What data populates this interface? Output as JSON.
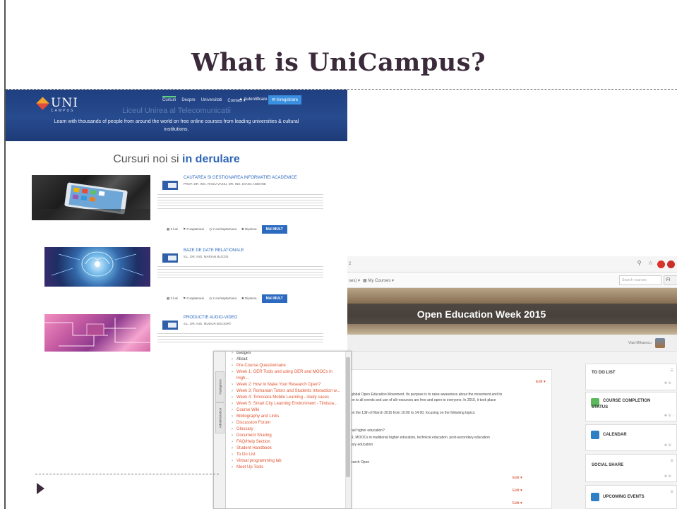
{
  "slide": {
    "title": "What is UniCampus?"
  },
  "unicampus": {
    "logo_text": "UNI",
    "logo_sub": "CAMPUS",
    "nav": [
      "Cursuri",
      "Despre",
      "Universitati",
      "Contact ▾"
    ],
    "login_label": "▲ Autentificare",
    "register_label": "✉ Inregistrare",
    "hero_faded": "Liceul Unirea al Telecomunicatii",
    "hero_text": "Learn with thousands of people from around the world on free online courses from leading universities & cultural institutions.",
    "section_title_pre": "Cursuri noi si ",
    "section_title_highlight": "in derulare",
    "courses": [
      {
        "title": "CAUTAREA SI GESTIONAREA INFORMATIEI ACADEMICE",
        "authors": "PROF. DR. ING. RADU VASIU, DR. ING. DIANA ANDONE",
        "meta": [
          "▦ 3 luni",
          "⚑ 0 saptamani",
          "◷ 2 ore/saptamana",
          "✱ Diploma"
        ],
        "button": "MAI MULT"
      },
      {
        "title": "BAZE DE DATE RELATIONALE",
        "authors": "S.L. DR. ING. MARIAN BUCOS",
        "meta": [
          "▦ 3 luni",
          "⚑ 0 saptamani",
          "◷ 2 ore/saptamana",
          "✱ Diploma"
        ],
        "button": "MAI MULT"
      },
      {
        "title": "PRODUCTIE AUDIO-VIDEO",
        "authors": "S.L. DR. ING. MUGUR BOCIORT"
      }
    ]
  },
  "moodle": {
    "addr_fragment": "2",
    "menu_fragment": "ses) ▾",
    "my_courses": "▦ My Courses ▾",
    "search_placeholder": "Search courses",
    "lang_label": "Fl",
    "banner_title": "Open Education Week 2015",
    "user_name": "Vlad Mihaescu",
    "edit_label": "Edit ▾",
    "content_lines": [
      "global Open Education Movement. Its purpose is to raise awareness about the movement and its",
      "on to all events and use of all resources are free and open to everyone. In 2015, it took place",
      "on the 13th of March 2015 from 10:00 to 14:00, focusing on the following topics:",
      "nal higher education?",
      "R, MOOCs in traditional higher education, technical education, post-secondary education",
      "lary education",
      "earch Open"
    ],
    "blocks": [
      {
        "title": "TO DO LIST"
      },
      {
        "title": "COURSE COMPLETION",
        "title2": "STATUS"
      },
      {
        "title": "CALENDAR"
      },
      {
        "title": "SOCIAL SHARE"
      },
      {
        "title": "UPCOMING EVENTS"
      }
    ]
  },
  "navigation": {
    "tabs": [
      "Navigation",
      "Administration"
    ],
    "items": [
      {
        "label": "Badges",
        "style": "dark"
      },
      {
        "label": "About",
        "style": "dark"
      },
      {
        "label": "Pre-Course Questionnaire"
      },
      {
        "label": "Week 1: OER Tools and using OER and MOOCs in High..."
      },
      {
        "label": "Week 2: How to Make Your Research Open?"
      },
      {
        "label": "Week 3: Romanian Tutors and Students Interaction w..."
      },
      {
        "label": "Week 4: Timisoara Mobile Learning - study cases"
      },
      {
        "label": "Week 5: Smart City Learning Environment - Timisoa..."
      },
      {
        "label": "Course Wiki"
      },
      {
        "label": "Bibliography and Links"
      },
      {
        "label": "Discussion Forum"
      },
      {
        "label": "Glossary"
      },
      {
        "label": "Document Sharing"
      },
      {
        "label": "FAQ/Help Section"
      },
      {
        "label": "Student Handbook"
      },
      {
        "label": "To Do List"
      },
      {
        "label": "Virtual programming lab"
      },
      {
        "label": "Meet Up Tools"
      }
    ]
  },
  "colors": {
    "title": "#3b2b3a",
    "hero_blue": "#274b8f",
    "link_blue": "#2c6ac0",
    "nav_orange": "#e1532f"
  }
}
